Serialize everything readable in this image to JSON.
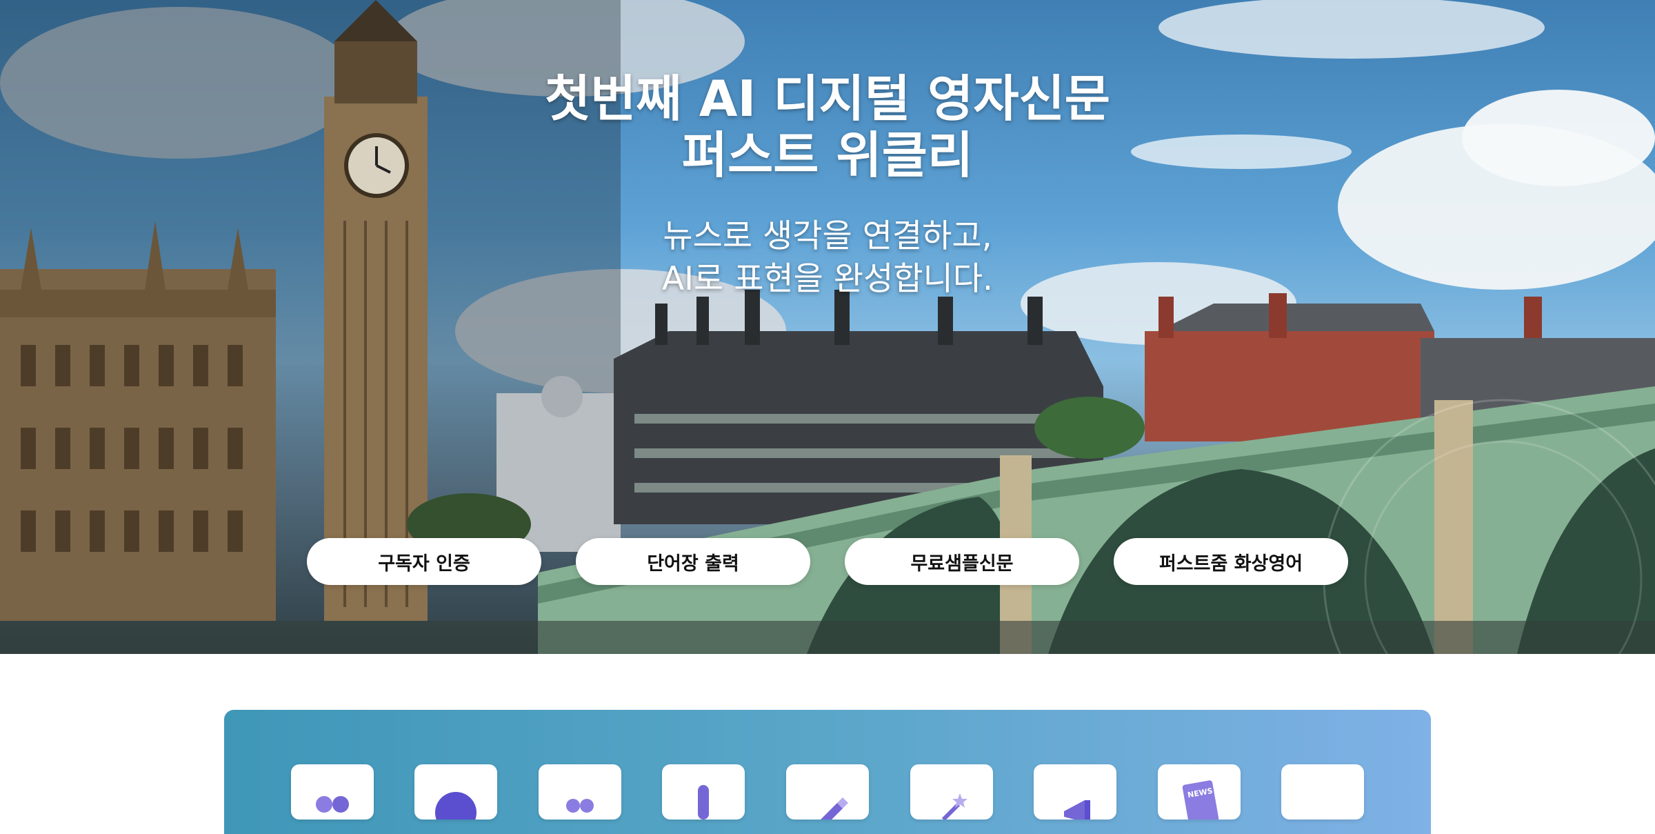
{
  "hero": {
    "title_line1": "첫번째 AI 디지털 영자신문",
    "title_line2": "퍼스트 위클리",
    "subtitle_line1": "뉴스로 생각을 연결하고,",
    "subtitle_line2": "AI로 표현을 완성합니다.",
    "buttons": [
      {
        "label": "구독자 인증"
      },
      {
        "label": "단어장 출력"
      },
      {
        "label": "무료샘플신문"
      },
      {
        "label": "퍼스트줌 화상영어"
      }
    ]
  },
  "features": {
    "accent_gradient": [
      "#3f97b8",
      "#7fb1e6"
    ],
    "icon_color": "#6b5fd6",
    "icons": [
      "people-icon",
      "globe-icon",
      "group-icon",
      "microphone-icon",
      "pencil-icon",
      "magic-wand-icon",
      "megaphone-icon",
      "news-icon",
      "book-icon"
    ],
    "news_icon_text": "NEWS"
  }
}
